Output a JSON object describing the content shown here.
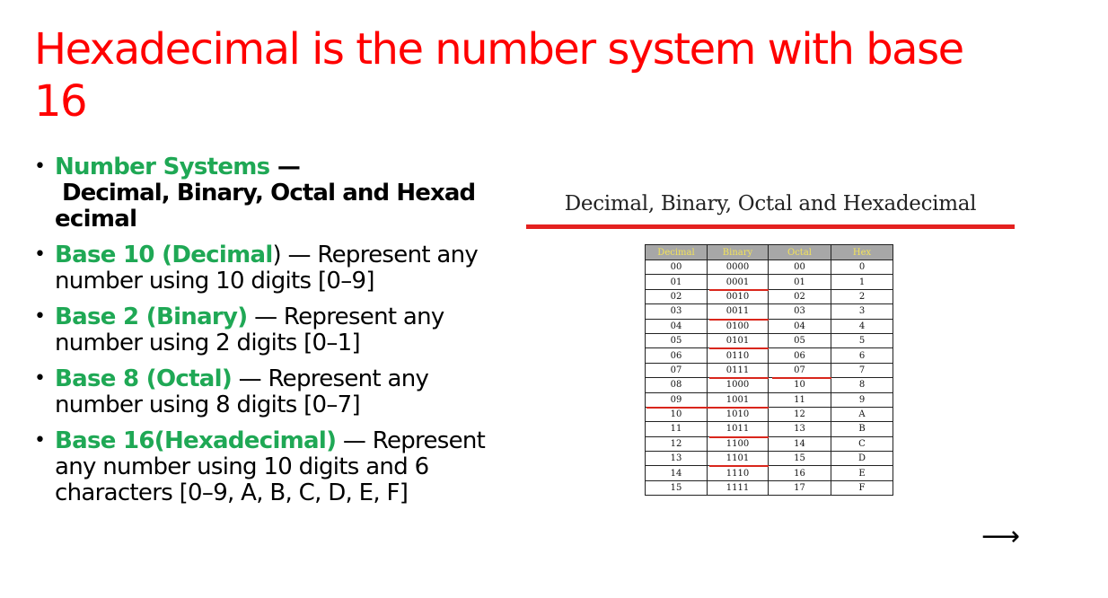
{
  "slide": {
    "title": "Hexadecimal is the number system with base 16"
  },
  "bullets": [
    {
      "head": "Number Systems",
      "sep": " —",
      "sub1": "Decimal, Binary, Octal and Hexad",
      "sub2": "ecimal"
    },
    {
      "head_green": "Base 10 (Decimal",
      "head_black": ")",
      "rest": " — Represent any number using 10 digits [0–9]"
    },
    {
      "head_green": "Base 2 (Binary)",
      "rest": " — Represent any number using 2 digits [0–1]"
    },
    {
      "head_green": "Base 8 (Octal)",
      "rest": " — Represent any number using 8 digits [0–7]"
    },
    {
      "head_green": "Base 16(Hexadecimal)",
      "rest": " — Represent any number using 10 digits and 6 characters [0–9, A, B, C, D, E, F]"
    }
  ],
  "figure": {
    "caption": "Decimal, Binary, Octal and Hexadecimal",
    "rule_color": "#e4211f"
  },
  "table": {
    "headers": [
      "Decimal",
      "Binary",
      "Octal",
      "Hex"
    ],
    "rows": [
      [
        "00",
        "0000",
        "00",
        "0"
      ],
      [
        "01",
        "0001",
        "01",
        "1"
      ],
      [
        "02",
        "0010",
        "02",
        "2"
      ],
      [
        "03",
        "0011",
        "03",
        "3"
      ],
      [
        "04",
        "0100",
        "04",
        "4"
      ],
      [
        "05",
        "0101",
        "05",
        "5"
      ],
      [
        "06",
        "0110",
        "06",
        "6"
      ],
      [
        "07",
        "0111",
        "07",
        "7"
      ],
      [
        "08",
        "1000",
        "10",
        "8"
      ],
      [
        "09",
        "1001",
        "11",
        "9"
      ],
      [
        "10",
        "1010",
        "12",
        "A"
      ],
      [
        "11",
        "1011",
        "13",
        "B"
      ],
      [
        "12",
        "1100",
        "14",
        "C"
      ],
      [
        "13",
        "1101",
        "15",
        "D"
      ],
      [
        "14",
        "1110",
        "16",
        "E"
      ],
      [
        "15",
        "1111",
        "17",
        "F"
      ]
    ]
  },
  "colors": {
    "title": "#ff0000",
    "accent_green": "#1fa855",
    "header_bg": "#a7a7a7",
    "header_text": "#f3e35a"
  },
  "nav": {
    "next_icon": "right-arrow-icon"
  }
}
